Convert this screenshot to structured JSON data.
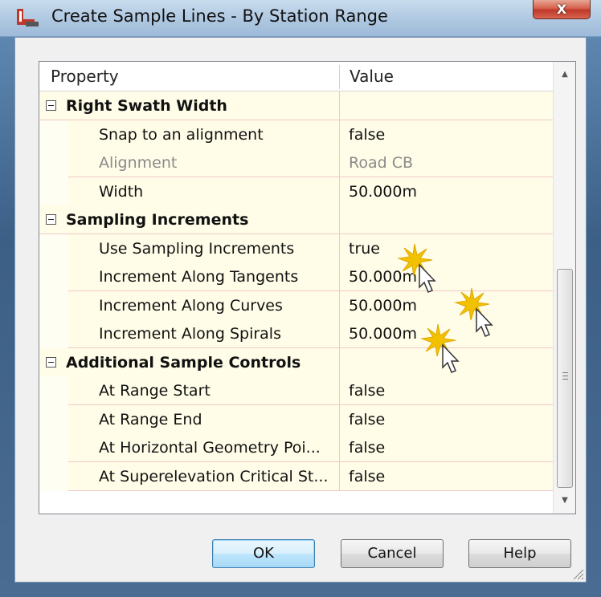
{
  "window": {
    "title": "Create Sample Lines - By Station Range",
    "close_label": "X"
  },
  "grid": {
    "header": {
      "property": "Property",
      "value": "Value"
    },
    "rows": [
      {
        "kind": "category",
        "name": "Right Swath Width",
        "value": ""
      },
      {
        "kind": "property",
        "name": "Snap to an alignment",
        "value": "false",
        "disabled": false
      },
      {
        "kind": "property",
        "name": "Alignment",
        "value": "Road CB",
        "disabled": true
      },
      {
        "kind": "property",
        "name": "Width",
        "value": "50.000m",
        "disabled": false
      },
      {
        "kind": "category",
        "name": "Sampling Increments",
        "value": ""
      },
      {
        "kind": "property",
        "name": "Use Sampling Increments",
        "value": "true",
        "disabled": false
      },
      {
        "kind": "property",
        "name": "Increment Along Tangents",
        "value": "50.000m",
        "disabled": false
      },
      {
        "kind": "property",
        "name": "Increment Along Curves",
        "value": "50.000m",
        "disabled": false
      },
      {
        "kind": "property",
        "name": "Increment Along Spirals",
        "value": "50.000m",
        "disabled": false
      },
      {
        "kind": "category",
        "name": "Additional Sample Controls",
        "value": ""
      },
      {
        "kind": "property",
        "name": "At Range Start",
        "value": "false",
        "disabled": false
      },
      {
        "kind": "property",
        "name": "At Range End",
        "value": "false",
        "disabled": false
      },
      {
        "kind": "property",
        "name": "At Horizontal Geometry Poi...",
        "value": "false",
        "disabled": false
      },
      {
        "kind": "property",
        "name": "At Superelevation Critical St...",
        "value": "false",
        "disabled": false
      }
    ]
  },
  "buttons": {
    "ok": "OK",
    "cancel": "Cancel",
    "help": "Help"
  },
  "icons": {
    "app": "civil3d-app-icon",
    "cursor": "click-cursor-icon",
    "expander": "collapse-minus-icon"
  },
  "colors": {
    "title_bar": "#b3cbe3",
    "close_button": "#c0392b",
    "grid_row_bg": "#fffde8",
    "grid_line": "#f0c8c8",
    "client_bg": "#f0f0f0"
  }
}
